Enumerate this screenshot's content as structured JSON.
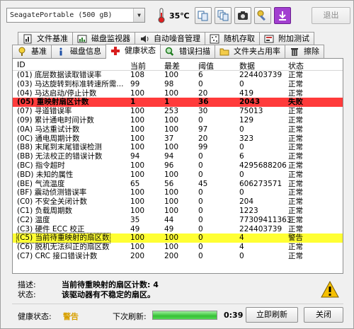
{
  "toolbar": {
    "drive": "SeagatePortable (500 gB)",
    "temperature": "35℃",
    "exit_label": "退出",
    "colors": {
      "exit_disabled": "#8a8a8a",
      "accent": "#a23fd0"
    }
  },
  "tabs_row1": [
    {
      "label": "文件基准",
      "icon": "file-benchmark-icon"
    },
    {
      "label": "磁盘监视器",
      "icon": "disk-monitor-icon"
    },
    {
      "label": "自动噪音管理",
      "icon": "speaker-icon"
    },
    {
      "label": "随机存取",
      "icon": "random-access-icon"
    },
    {
      "label": "附加测试",
      "icon": "extra-tests-icon"
    }
  ],
  "tabs_row2": [
    {
      "label": "基准",
      "icon": "benchmark-icon"
    },
    {
      "label": "磁盘信息",
      "icon": "info-icon"
    },
    {
      "label": "健康状态",
      "icon": "health-cross-icon",
      "active": true
    },
    {
      "label": "错误扫描",
      "icon": "magnifier-icon"
    },
    {
      "label": "文件夹占用率",
      "icon": "folder-icon"
    },
    {
      "label": "擦除",
      "icon": "trash-icon"
    }
  ],
  "table": {
    "headers": {
      "id": "ID",
      "current": "当前",
      "worst": "最差",
      "threshold": "阈值",
      "data": "数据",
      "status": "状态"
    },
    "rows": [
      {
        "id": "(01) 底层数据读取错误率",
        "current": "108",
        "worst": "100",
        "threshold": "6",
        "data": "224403739",
        "status": "正常"
      },
      {
        "id": "(03) 马达旋转到标准转速所需...",
        "current": "99",
        "worst": "98",
        "threshold": "0",
        "data": "0",
        "status": "正常"
      },
      {
        "id": "(04) 马达启动/停止计数",
        "current": "100",
        "worst": "100",
        "threshold": "20",
        "data": "419",
        "status": "正常"
      },
      {
        "id": "(05) 重映射扇区计数",
        "current": "1",
        "worst": "1",
        "threshold": "36",
        "data": "2043",
        "status": "失败",
        "level": "fail"
      },
      {
        "id": "(07) 寻道错误率",
        "current": "100",
        "worst": "253",
        "threshold": "30",
        "data": "75013",
        "status": "正常"
      },
      {
        "id": "(09) 累计通电时间计数",
        "current": "100",
        "worst": "100",
        "threshold": "0",
        "data": "129",
        "status": "正常"
      },
      {
        "id": "(0A) 马达重试计数",
        "current": "100",
        "worst": "100",
        "threshold": "97",
        "data": "0",
        "status": "正常"
      },
      {
        "id": "(0C) 通电周期计数",
        "current": "100",
        "worst": "37",
        "threshold": "20",
        "data": "323",
        "status": "正常"
      },
      {
        "id": "(B8) 末尾到末尾错误检测",
        "current": "100",
        "worst": "100",
        "threshold": "99",
        "data": "0",
        "status": "正常"
      },
      {
        "id": "(BB) 无法校正的错误计数",
        "current": "94",
        "worst": "94",
        "threshold": "0",
        "data": "6",
        "status": "正常"
      },
      {
        "id": "(BC) 指令超时",
        "current": "100",
        "worst": "96",
        "threshold": "0",
        "data": "4295688206",
        "status": "正常"
      },
      {
        "id": "(BD) 未知的属性",
        "current": "100",
        "worst": "100",
        "threshold": "0",
        "data": "0",
        "status": "正常"
      },
      {
        "id": "(BE) 气流温度",
        "current": "65",
        "worst": "56",
        "threshold": "45",
        "data": "606273571",
        "status": "正常"
      },
      {
        "id": "(BF) 震动侦测错误率",
        "current": "100",
        "worst": "100",
        "threshold": "0",
        "data": "0",
        "status": "正常"
      },
      {
        "id": "(C0) 不安全关闭计数",
        "current": "100",
        "worst": "100",
        "threshold": "0",
        "data": "204",
        "status": "正常"
      },
      {
        "id": "(C1) 负载周期数",
        "current": "100",
        "worst": "100",
        "threshold": "0",
        "data": "1223",
        "status": "正常"
      },
      {
        "id": "(C2) 温度",
        "current": "35",
        "worst": "44",
        "threshold": "0",
        "data": "77309411363",
        "status": "正常"
      },
      {
        "id": "(C3) 硬件 ECC 校正",
        "current": "49",
        "worst": "49",
        "threshold": "0",
        "data": "224403739",
        "status": "正常"
      },
      {
        "id": "(C5) 当前待重映射的扇区数",
        "current": "100",
        "worst": "100",
        "threshold": "0",
        "data": "4",
        "status": "警告",
        "level": "warn"
      },
      {
        "id": "(C6) 脱机无法纠正的扇区数",
        "current": "100",
        "worst": "100",
        "threshold": "0",
        "data": "4",
        "status": "正常"
      },
      {
        "id": "(C7) CRC 接口错误计数",
        "current": "200",
        "worst": "200",
        "threshold": "0",
        "data": "0",
        "status": "正常"
      }
    ],
    "colors": {
      "fail_row": "#ff3b3b",
      "warn_row": "#ffff33"
    }
  },
  "description": {
    "desc_label": "描述:",
    "desc_value": "当前待重映射的扇区计数: 4",
    "state_label": "状态:",
    "state_value": "该驱动器有不稳定的扇区。"
  },
  "status_bar": {
    "health_label": "健康状态:",
    "health_value": "警告",
    "refresh_label": "下次刷新:",
    "progress": 1.0,
    "countdown": "0:39",
    "refresh_button": "立即刷新",
    "close_button": "关闭",
    "colors": {
      "health_warn": "#d8a000",
      "progress": "#35c135"
    }
  }
}
